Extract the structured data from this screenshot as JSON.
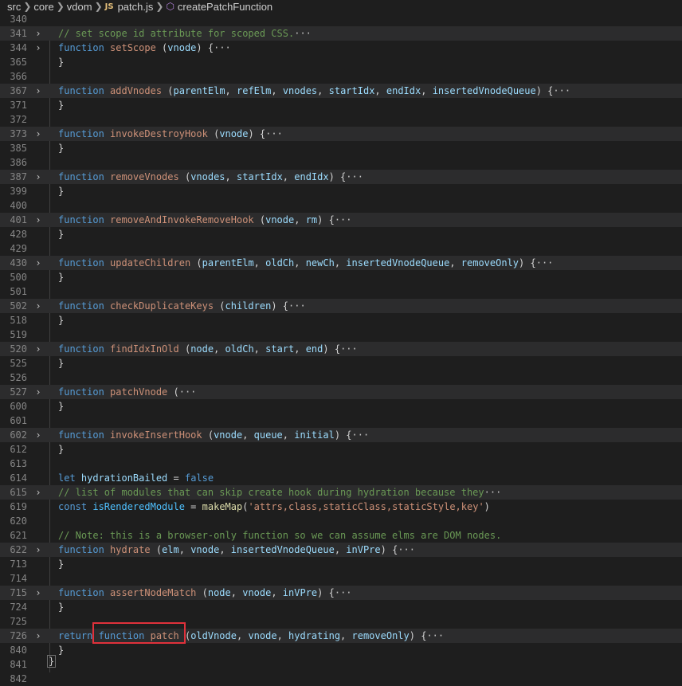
{
  "breadcrumb": {
    "items": [
      "src",
      "core",
      "vdom",
      "patch.js",
      "createPatchFunction"
    ],
    "js_badge": "JS"
  },
  "lines": [
    {
      "n": "340",
      "fold": false,
      "tokens": []
    },
    {
      "n": "341",
      "fold": true,
      "folded": true,
      "tokens": [
        {
          "c": "cmt",
          "t": "// set scope id attribute for scoped CSS."
        },
        {
          "c": "ell",
          "t": "···"
        }
      ]
    },
    {
      "n": "344",
      "fold": true,
      "folded": false,
      "tokens": [
        {
          "c": "kw",
          "t": "function "
        },
        {
          "c": "fnname",
          "t": "setScope"
        },
        {
          "c": "punc",
          "t": " ("
        },
        {
          "c": "param",
          "t": "vnode"
        },
        {
          "c": "punc",
          "t": ") {"
        },
        {
          "c": "ell",
          "t": "···"
        }
      ]
    },
    {
      "n": "365",
      "fold": false,
      "tokens": [
        {
          "c": "punc",
          "t": "}"
        }
      ]
    },
    {
      "n": "366",
      "fold": false,
      "tokens": []
    },
    {
      "n": "367",
      "fold": true,
      "folded": true,
      "tokens": [
        {
          "c": "kw",
          "t": "function "
        },
        {
          "c": "fnname",
          "t": "addVnodes"
        },
        {
          "c": "punc",
          "t": " ("
        },
        {
          "c": "param",
          "t": "parentElm"
        },
        {
          "c": "punc",
          "t": ", "
        },
        {
          "c": "param",
          "t": "refElm"
        },
        {
          "c": "punc",
          "t": ", "
        },
        {
          "c": "param",
          "t": "vnodes"
        },
        {
          "c": "punc",
          "t": ", "
        },
        {
          "c": "param",
          "t": "startIdx"
        },
        {
          "c": "punc",
          "t": ", "
        },
        {
          "c": "param",
          "t": "endIdx"
        },
        {
          "c": "punc",
          "t": ", "
        },
        {
          "c": "param",
          "t": "insertedVnodeQueue"
        },
        {
          "c": "punc",
          "t": ") {"
        },
        {
          "c": "ell",
          "t": "···"
        }
      ]
    },
    {
      "n": "371",
      "fold": false,
      "tokens": [
        {
          "c": "punc",
          "t": "}"
        }
      ]
    },
    {
      "n": "372",
      "fold": false,
      "tokens": []
    },
    {
      "n": "373",
      "fold": true,
      "folded": true,
      "tokens": [
        {
          "c": "kw",
          "t": "function "
        },
        {
          "c": "fnname",
          "t": "invokeDestroyHook"
        },
        {
          "c": "punc",
          "t": " ("
        },
        {
          "c": "param",
          "t": "vnode"
        },
        {
          "c": "punc",
          "t": ") {"
        },
        {
          "c": "ell",
          "t": "···"
        }
      ]
    },
    {
      "n": "385",
      "fold": false,
      "tokens": [
        {
          "c": "punc",
          "t": "}"
        }
      ]
    },
    {
      "n": "386",
      "fold": false,
      "tokens": []
    },
    {
      "n": "387",
      "fold": true,
      "folded": true,
      "tokens": [
        {
          "c": "kw",
          "t": "function "
        },
        {
          "c": "fnname",
          "t": "removeVnodes"
        },
        {
          "c": "punc",
          "t": " ("
        },
        {
          "c": "param",
          "t": "vnodes"
        },
        {
          "c": "punc",
          "t": ", "
        },
        {
          "c": "param",
          "t": "startIdx"
        },
        {
          "c": "punc",
          "t": ", "
        },
        {
          "c": "param",
          "t": "endIdx"
        },
        {
          "c": "punc",
          "t": ") {"
        },
        {
          "c": "ell",
          "t": "···"
        }
      ]
    },
    {
      "n": "399",
      "fold": false,
      "tokens": [
        {
          "c": "punc",
          "t": "}"
        }
      ]
    },
    {
      "n": "400",
      "fold": false,
      "tokens": []
    },
    {
      "n": "401",
      "fold": true,
      "folded": true,
      "tokens": [
        {
          "c": "kw",
          "t": "function "
        },
        {
          "c": "fnname",
          "t": "removeAndInvokeRemoveHook"
        },
        {
          "c": "punc",
          "t": " ("
        },
        {
          "c": "param",
          "t": "vnode"
        },
        {
          "c": "punc",
          "t": ", "
        },
        {
          "c": "param",
          "t": "rm"
        },
        {
          "c": "punc",
          "t": ") {"
        },
        {
          "c": "ell",
          "t": "···"
        }
      ]
    },
    {
      "n": "428",
      "fold": false,
      "tokens": [
        {
          "c": "punc",
          "t": "}"
        }
      ]
    },
    {
      "n": "429",
      "fold": false,
      "tokens": []
    },
    {
      "n": "430",
      "fold": true,
      "folded": true,
      "tokens": [
        {
          "c": "kw",
          "t": "function "
        },
        {
          "c": "fnname",
          "t": "updateChildren"
        },
        {
          "c": "punc",
          "t": " ("
        },
        {
          "c": "param",
          "t": "parentElm"
        },
        {
          "c": "punc",
          "t": ", "
        },
        {
          "c": "param",
          "t": "oldCh"
        },
        {
          "c": "punc",
          "t": ", "
        },
        {
          "c": "param",
          "t": "newCh"
        },
        {
          "c": "punc",
          "t": ", "
        },
        {
          "c": "param",
          "t": "insertedVnodeQueue"
        },
        {
          "c": "punc",
          "t": ", "
        },
        {
          "c": "param",
          "t": "removeOnly"
        },
        {
          "c": "punc",
          "t": ") {"
        },
        {
          "c": "ell",
          "t": "···"
        }
      ]
    },
    {
      "n": "500",
      "fold": false,
      "tokens": [
        {
          "c": "punc",
          "t": "}"
        }
      ]
    },
    {
      "n": "501",
      "fold": false,
      "tokens": []
    },
    {
      "n": "502",
      "fold": true,
      "folded": true,
      "tokens": [
        {
          "c": "kw",
          "t": "function "
        },
        {
          "c": "fnname",
          "t": "checkDuplicateKeys"
        },
        {
          "c": "punc",
          "t": " ("
        },
        {
          "c": "param",
          "t": "children"
        },
        {
          "c": "punc",
          "t": ") {"
        },
        {
          "c": "ell",
          "t": "···"
        }
      ]
    },
    {
      "n": "518",
      "fold": false,
      "tokens": [
        {
          "c": "punc",
          "t": "}"
        }
      ]
    },
    {
      "n": "519",
      "fold": false,
      "tokens": []
    },
    {
      "n": "520",
      "fold": true,
      "folded": true,
      "tokens": [
        {
          "c": "kw",
          "t": "function "
        },
        {
          "c": "fnname",
          "t": "findIdxInOld"
        },
        {
          "c": "punc",
          "t": " ("
        },
        {
          "c": "param",
          "t": "node"
        },
        {
          "c": "punc",
          "t": ", "
        },
        {
          "c": "param",
          "t": "oldCh"
        },
        {
          "c": "punc",
          "t": ", "
        },
        {
          "c": "param",
          "t": "start"
        },
        {
          "c": "punc",
          "t": ", "
        },
        {
          "c": "param",
          "t": "end"
        },
        {
          "c": "punc",
          "t": ") {"
        },
        {
          "c": "ell",
          "t": "···"
        }
      ]
    },
    {
      "n": "525",
      "fold": false,
      "tokens": [
        {
          "c": "punc",
          "t": "}"
        }
      ]
    },
    {
      "n": "526",
      "fold": false,
      "tokens": []
    },
    {
      "n": "527",
      "fold": true,
      "folded": true,
      "tokens": [
        {
          "c": "kw",
          "t": "function "
        },
        {
          "c": "fnname",
          "t": "patchVnode"
        },
        {
          "c": "punc",
          "t": " ("
        },
        {
          "c": "ell",
          "t": "···"
        }
      ]
    },
    {
      "n": "600",
      "fold": false,
      "tokens": [
        {
          "c": "punc",
          "t": "}"
        }
      ]
    },
    {
      "n": "601",
      "fold": false,
      "tokens": []
    },
    {
      "n": "602",
      "fold": true,
      "folded": true,
      "tokens": [
        {
          "c": "kw",
          "t": "function "
        },
        {
          "c": "fnname",
          "t": "invokeInsertHook"
        },
        {
          "c": "punc",
          "t": " ("
        },
        {
          "c": "param",
          "t": "vnode"
        },
        {
          "c": "punc",
          "t": ", "
        },
        {
          "c": "param",
          "t": "queue"
        },
        {
          "c": "punc",
          "t": ", "
        },
        {
          "c": "param",
          "t": "initial"
        },
        {
          "c": "punc",
          "t": ") {"
        },
        {
          "c": "ell",
          "t": "···"
        }
      ]
    },
    {
      "n": "612",
      "fold": false,
      "tokens": [
        {
          "c": "punc",
          "t": "}"
        }
      ]
    },
    {
      "n": "613",
      "fold": false,
      "tokens": []
    },
    {
      "n": "614",
      "fold": false,
      "tokens": [
        {
          "c": "kw",
          "t": "let "
        },
        {
          "c": "param",
          "t": "hydrationBailed"
        },
        {
          "c": "punc",
          "t": " = "
        },
        {
          "c": "bool",
          "t": "false"
        }
      ]
    },
    {
      "n": "615",
      "fold": true,
      "folded": true,
      "tokens": [
        {
          "c": "cmt",
          "t": "// list of modules that can skip create hook during hydration because they"
        },
        {
          "c": "ell",
          "t": "···"
        }
      ]
    },
    {
      "n": "619",
      "fold": false,
      "tokens": [
        {
          "c": "kw",
          "t": "const "
        },
        {
          "c": "var",
          "t": "isRenderedModule"
        },
        {
          "c": "punc",
          "t": " = "
        },
        {
          "c": "fn",
          "t": "makeMap"
        },
        {
          "c": "punc",
          "t": "("
        },
        {
          "c": "str",
          "t": "'attrs,class,staticClass,staticStyle,key'"
        },
        {
          "c": "punc",
          "t": ")"
        }
      ]
    },
    {
      "n": "620",
      "fold": false,
      "tokens": []
    },
    {
      "n": "621",
      "fold": false,
      "tokens": [
        {
          "c": "cmt",
          "t": "// Note: this is a browser-only function so we can assume elms are DOM nodes."
        }
      ]
    },
    {
      "n": "622",
      "fold": true,
      "folded": true,
      "tokens": [
        {
          "c": "kw",
          "t": "function "
        },
        {
          "c": "fnname",
          "t": "hydrate"
        },
        {
          "c": "punc",
          "t": " ("
        },
        {
          "c": "param",
          "t": "elm"
        },
        {
          "c": "punc",
          "t": ", "
        },
        {
          "c": "param",
          "t": "vnode"
        },
        {
          "c": "punc",
          "t": ", "
        },
        {
          "c": "param",
          "t": "insertedVnodeQueue"
        },
        {
          "c": "punc",
          "t": ", "
        },
        {
          "c": "param",
          "t": "inVPre"
        },
        {
          "c": "punc",
          "t": ") {"
        },
        {
          "c": "ell",
          "t": "···"
        }
      ]
    },
    {
      "n": "713",
      "fold": false,
      "tokens": [
        {
          "c": "punc",
          "t": "}"
        }
      ]
    },
    {
      "n": "714",
      "fold": false,
      "tokens": []
    },
    {
      "n": "715",
      "fold": true,
      "folded": true,
      "tokens": [
        {
          "c": "kw",
          "t": "function "
        },
        {
          "c": "fnname",
          "t": "assertNodeMatch"
        },
        {
          "c": "punc",
          "t": " ("
        },
        {
          "c": "param",
          "t": "node"
        },
        {
          "c": "punc",
          "t": ", "
        },
        {
          "c": "param",
          "t": "vnode"
        },
        {
          "c": "punc",
          "t": ", "
        },
        {
          "c": "param",
          "t": "inVPre"
        },
        {
          "c": "punc",
          "t": ") {"
        },
        {
          "c": "ell",
          "t": "···"
        }
      ]
    },
    {
      "n": "724",
      "fold": false,
      "tokens": [
        {
          "c": "punc",
          "t": "}"
        }
      ]
    },
    {
      "n": "725",
      "fold": false,
      "tokens": []
    },
    {
      "n": "726",
      "fold": true,
      "folded": true,
      "tokens": [
        {
          "c": "kw",
          "t": "return "
        },
        {
          "c": "kw",
          "t": "function "
        },
        {
          "c": "fnname",
          "t": "patch"
        },
        {
          "c": "punc",
          "t": " ("
        },
        {
          "c": "param",
          "t": "oldVnode"
        },
        {
          "c": "punc",
          "t": ", "
        },
        {
          "c": "param",
          "t": "vnode"
        },
        {
          "c": "punc",
          "t": ", "
        },
        {
          "c": "param",
          "t": "hydrating"
        },
        {
          "c": "punc",
          "t": ", "
        },
        {
          "c": "param",
          "t": "removeOnly"
        },
        {
          "c": "punc",
          "t": ") {"
        },
        {
          "c": "ell",
          "t": "···"
        }
      ]
    },
    {
      "n": "840",
      "fold": false,
      "tokens": [
        {
          "c": "punc",
          "t": "}"
        }
      ]
    },
    {
      "n": "841",
      "fold": false,
      "tokens": []
    },
    {
      "n": "842",
      "fold": false,
      "tokens": []
    }
  ],
  "closing_brace": "}",
  "fold_glyph": "›",
  "colors": {
    "background": "#1e1e1e",
    "folded_line": "#2c2c2d",
    "highlight_box": "#e0313b"
  }
}
